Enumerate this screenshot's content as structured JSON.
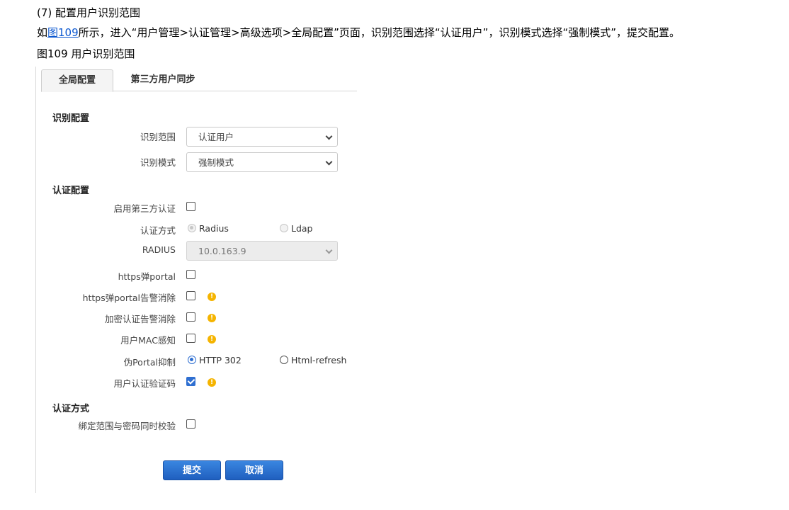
{
  "doc": {
    "step": "(7)   配置用户识别范围",
    "instruction_pre": "如",
    "instruction_link": "图109",
    "instruction_post": "所示，进入“用户管理>认证管理>高级选项>全局配置”页面，识别范围选择“认证用户”，识别模式选择“强制模式”，提交配置。",
    "figure_caption": "图109 用户识别范围"
  },
  "tabs": [
    "全局配置",
    "第三方用户同步"
  ],
  "identify_section": {
    "title": "识别配置",
    "scope_label": "识别范围",
    "scope_value": "认证用户",
    "mode_label": "识别模式",
    "mode_value": "强制模式"
  },
  "auth_section": {
    "title": "认证配置",
    "third_party_label": "启用第三方认证",
    "auth_method_label": "认证方式",
    "auth_method_options": [
      "Radius",
      "Ldap"
    ],
    "radius_label": "RADIUS",
    "radius_value": "10.0.163.9",
    "https_portal_label": "https弹portal",
    "https_portal_alarm_label": "https弹portal告警消除",
    "encrypt_alarm_label": "加密认证告警消除",
    "mac_sense_label": "用户MAC感知",
    "fake_portal_label": "伪Portal抑制",
    "fake_portal_options": [
      "HTTP 302",
      "Html-refresh"
    ],
    "captcha_label": "用户认证验证码"
  },
  "method_section": {
    "title": "认证方式",
    "bind_label": "绑定范围与密码同时校验"
  },
  "buttons": {
    "submit": "提交",
    "cancel": "取消"
  },
  "checkbox_states": {
    "third_party": false,
    "https_portal": false,
    "https_portal_alarm": false,
    "encrypt_alarm": false,
    "mac_sense": false,
    "captcha": true,
    "bind": false
  },
  "selected_auth_method": "Radius",
  "selected_fake_portal": "HTTP 302",
  "colors": {
    "accent": "#2f6fd1",
    "warning": "#f5b400",
    "button": "#1f5fbf"
  }
}
